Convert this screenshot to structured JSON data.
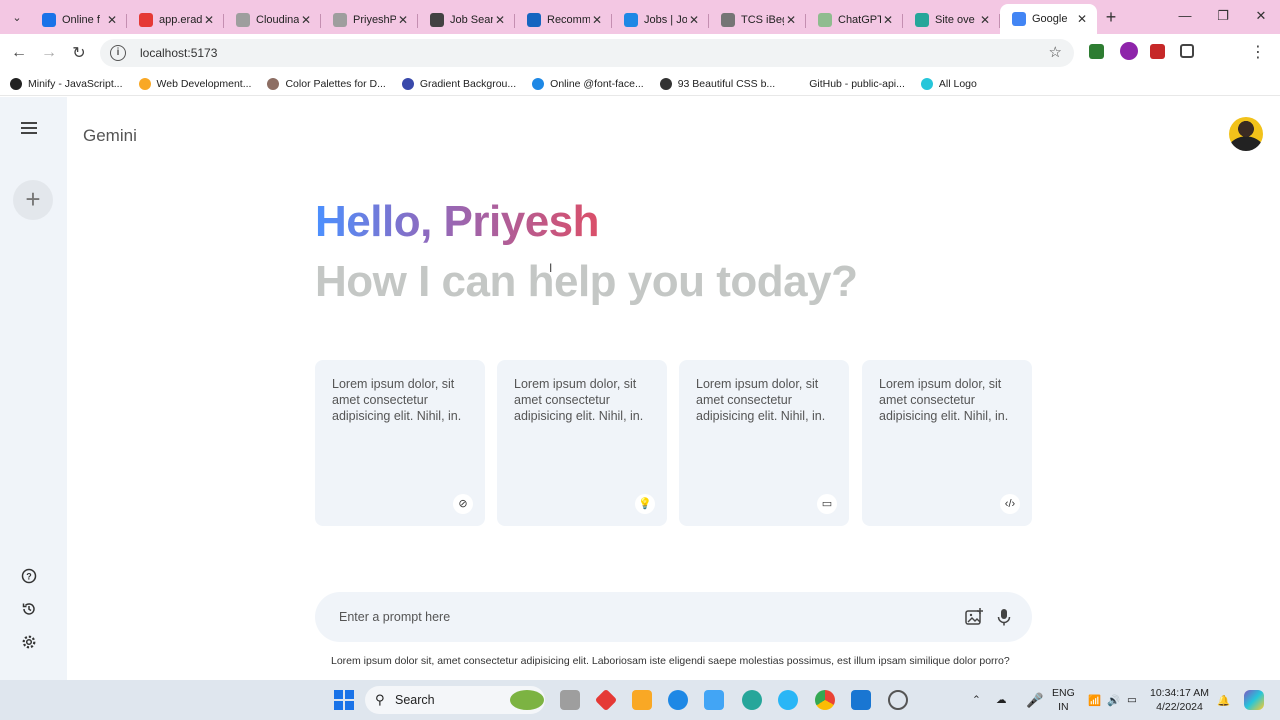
{
  "browser": {
    "tabs": [
      {
        "title": "Online f",
        "color": "#1a73e8"
      },
      {
        "title": "app.erad",
        "color": "#e53935"
      },
      {
        "title": "Cloudina",
        "color": "#9e9e9e"
      },
      {
        "title": "PriyeshP",
        "color": "#9e9e9e"
      },
      {
        "title": "Job Sear",
        "color": "#424242"
      },
      {
        "title": "Recomm",
        "color": "#1565c0"
      },
      {
        "title": "Jobs | Jo",
        "color": "#1e88e5"
      },
      {
        "title": "TCS iBeg",
        "color": "#757575"
      },
      {
        "title": "ChatGPT",
        "color": "#8fbc8f"
      },
      {
        "title": "Site ove",
        "color": "#26a69a"
      },
      {
        "title": "Google",
        "color": "#4285f4"
      }
    ],
    "url": "localhost:5173",
    "bookmarks": [
      {
        "label": "Minify - JavaScript...",
        "color": "#222"
      },
      {
        "label": "Web Development...",
        "color": "#f9a825"
      },
      {
        "label": "Color Palettes for D...",
        "color": "#8d6e63"
      },
      {
        "label": "Gradient Backgrou...",
        "color": "#3949ab"
      },
      {
        "label": "Online @font-face...",
        "color": "#1e88e5"
      },
      {
        "label": "93 Beautiful CSS b...",
        "color": "#333"
      },
      {
        "label": "GitHub - public-api...",
        "color": "#fff"
      },
      {
        "label": "All Logo",
        "color": "#26c6da"
      }
    ]
  },
  "app": {
    "brand": "Gemini",
    "greeting": "Hello, Priyesh",
    "subtitle": "How I can help you today?",
    "cards": [
      {
        "text": "Lorem ipsum dolor, sit amet consectetur adipisicing elit. Nihil, in.",
        "icon": "compass-icon",
        "glyph": "⊘"
      },
      {
        "text": "Lorem ipsum dolor, sit amet consectetur adipisicing elit. Nihil, in.",
        "icon": "bulb-icon",
        "glyph": "💡"
      },
      {
        "text": "Lorem ipsum dolor, sit amet consectetur adipisicing elit. Nihil, in.",
        "icon": "message-icon",
        "glyph": "▭"
      },
      {
        "text": "Lorem ipsum dolor, sit amet consectetur adipisicing elit. Nihil, in.",
        "icon": "code-icon",
        "glyph": "‹/›"
      }
    ],
    "prompt_placeholder": "Enter a prompt here",
    "disclaimer": "Lorem ipsum dolor sit, amet consectetur adipisicing elit. Laboriosam iste eligendi saepe molestias possimus, est illum ipsam similique dolor porro?"
  },
  "taskbar": {
    "search_label": "Search",
    "lang_line1": "ENG",
    "lang_line2": "IN",
    "time": "10:34:17 AM",
    "date": "4/22/2024"
  }
}
